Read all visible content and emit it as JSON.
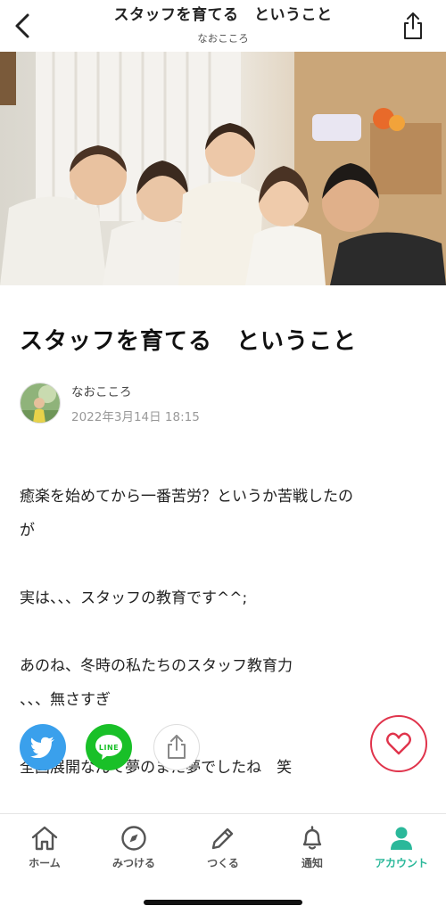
{
  "header": {
    "title": "スタッフを育てる　ということ",
    "subtitle": "なおこころ"
  },
  "article": {
    "title": "スタッフを育てる　ということ",
    "author": "なおこころ",
    "date": "2022年3月14日 18:15",
    "body": [
      "癒楽を始めてから一番苦労？というか苦戦したの",
      "が",
      "",
      "実は、、、スタッフの教育です^^;",
      "",
      "あのね、冬時の私たちのスタッフ教育力",
      "、、、無さすぎ",
      "",
      "全国展開なんて夢のまた夢でしたね　笑"
    ]
  },
  "share": {
    "line_label": "LINE"
  },
  "nav": {
    "items": [
      {
        "label": "ホーム",
        "icon": "home-icon"
      },
      {
        "label": "みつける",
        "icon": "compass-icon"
      },
      {
        "label": "つくる",
        "icon": "pencil-icon"
      },
      {
        "label": "通知",
        "icon": "bell-icon"
      },
      {
        "label": "アカウント",
        "icon": "person-icon"
      }
    ],
    "active_index": 4
  },
  "colors": {
    "accent": "#2bb89a",
    "like": "#e0344c",
    "twitter": "#3aa0ec",
    "line": "#19c028"
  }
}
